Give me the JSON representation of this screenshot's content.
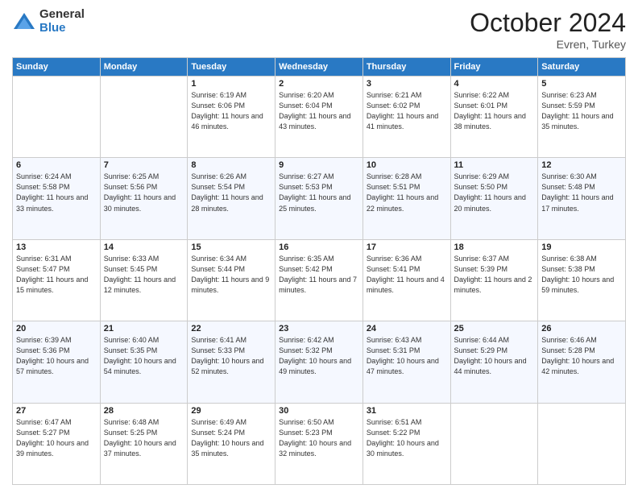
{
  "header": {
    "logo_general": "General",
    "logo_blue": "Blue",
    "month_title": "October 2024",
    "subtitle": "Evren, Turkey"
  },
  "days_of_week": [
    "Sunday",
    "Monday",
    "Tuesday",
    "Wednesday",
    "Thursday",
    "Friday",
    "Saturday"
  ],
  "weeks": [
    [
      {
        "day": "",
        "info": ""
      },
      {
        "day": "",
        "info": ""
      },
      {
        "day": "1",
        "info": "Sunrise: 6:19 AM\nSunset: 6:06 PM\nDaylight: 11 hours and 46 minutes."
      },
      {
        "day": "2",
        "info": "Sunrise: 6:20 AM\nSunset: 6:04 PM\nDaylight: 11 hours and 43 minutes."
      },
      {
        "day": "3",
        "info": "Sunrise: 6:21 AM\nSunset: 6:02 PM\nDaylight: 11 hours and 41 minutes."
      },
      {
        "day": "4",
        "info": "Sunrise: 6:22 AM\nSunset: 6:01 PM\nDaylight: 11 hours and 38 minutes."
      },
      {
        "day": "5",
        "info": "Sunrise: 6:23 AM\nSunset: 5:59 PM\nDaylight: 11 hours and 35 minutes."
      }
    ],
    [
      {
        "day": "6",
        "info": "Sunrise: 6:24 AM\nSunset: 5:58 PM\nDaylight: 11 hours and 33 minutes."
      },
      {
        "day": "7",
        "info": "Sunrise: 6:25 AM\nSunset: 5:56 PM\nDaylight: 11 hours and 30 minutes."
      },
      {
        "day": "8",
        "info": "Sunrise: 6:26 AM\nSunset: 5:54 PM\nDaylight: 11 hours and 28 minutes."
      },
      {
        "day": "9",
        "info": "Sunrise: 6:27 AM\nSunset: 5:53 PM\nDaylight: 11 hours and 25 minutes."
      },
      {
        "day": "10",
        "info": "Sunrise: 6:28 AM\nSunset: 5:51 PM\nDaylight: 11 hours and 22 minutes."
      },
      {
        "day": "11",
        "info": "Sunrise: 6:29 AM\nSunset: 5:50 PM\nDaylight: 11 hours and 20 minutes."
      },
      {
        "day": "12",
        "info": "Sunrise: 6:30 AM\nSunset: 5:48 PM\nDaylight: 11 hours and 17 minutes."
      }
    ],
    [
      {
        "day": "13",
        "info": "Sunrise: 6:31 AM\nSunset: 5:47 PM\nDaylight: 11 hours and 15 minutes."
      },
      {
        "day": "14",
        "info": "Sunrise: 6:33 AM\nSunset: 5:45 PM\nDaylight: 11 hours and 12 minutes."
      },
      {
        "day": "15",
        "info": "Sunrise: 6:34 AM\nSunset: 5:44 PM\nDaylight: 11 hours and 9 minutes."
      },
      {
        "day": "16",
        "info": "Sunrise: 6:35 AM\nSunset: 5:42 PM\nDaylight: 11 hours and 7 minutes."
      },
      {
        "day": "17",
        "info": "Sunrise: 6:36 AM\nSunset: 5:41 PM\nDaylight: 11 hours and 4 minutes."
      },
      {
        "day": "18",
        "info": "Sunrise: 6:37 AM\nSunset: 5:39 PM\nDaylight: 11 hours and 2 minutes."
      },
      {
        "day": "19",
        "info": "Sunrise: 6:38 AM\nSunset: 5:38 PM\nDaylight: 10 hours and 59 minutes."
      }
    ],
    [
      {
        "day": "20",
        "info": "Sunrise: 6:39 AM\nSunset: 5:36 PM\nDaylight: 10 hours and 57 minutes."
      },
      {
        "day": "21",
        "info": "Sunrise: 6:40 AM\nSunset: 5:35 PM\nDaylight: 10 hours and 54 minutes."
      },
      {
        "day": "22",
        "info": "Sunrise: 6:41 AM\nSunset: 5:33 PM\nDaylight: 10 hours and 52 minutes."
      },
      {
        "day": "23",
        "info": "Sunrise: 6:42 AM\nSunset: 5:32 PM\nDaylight: 10 hours and 49 minutes."
      },
      {
        "day": "24",
        "info": "Sunrise: 6:43 AM\nSunset: 5:31 PM\nDaylight: 10 hours and 47 minutes."
      },
      {
        "day": "25",
        "info": "Sunrise: 6:44 AM\nSunset: 5:29 PM\nDaylight: 10 hours and 44 minutes."
      },
      {
        "day": "26",
        "info": "Sunrise: 6:46 AM\nSunset: 5:28 PM\nDaylight: 10 hours and 42 minutes."
      }
    ],
    [
      {
        "day": "27",
        "info": "Sunrise: 6:47 AM\nSunset: 5:27 PM\nDaylight: 10 hours and 39 minutes."
      },
      {
        "day": "28",
        "info": "Sunrise: 6:48 AM\nSunset: 5:25 PM\nDaylight: 10 hours and 37 minutes."
      },
      {
        "day": "29",
        "info": "Sunrise: 6:49 AM\nSunset: 5:24 PM\nDaylight: 10 hours and 35 minutes."
      },
      {
        "day": "30",
        "info": "Sunrise: 6:50 AM\nSunset: 5:23 PM\nDaylight: 10 hours and 32 minutes."
      },
      {
        "day": "31",
        "info": "Sunrise: 6:51 AM\nSunset: 5:22 PM\nDaylight: 10 hours and 30 minutes."
      },
      {
        "day": "",
        "info": ""
      },
      {
        "day": "",
        "info": ""
      }
    ]
  ]
}
